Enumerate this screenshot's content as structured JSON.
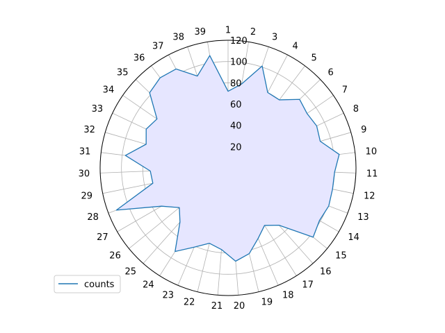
{
  "chart_data": {
    "type": "radar",
    "categories": [
      "1",
      "2",
      "3",
      "4",
      "5",
      "6",
      "7",
      "8",
      "9",
      "10",
      "11",
      "12",
      "13",
      "14",
      "15",
      "16",
      "17",
      "18",
      "19",
      "20",
      "21",
      "22",
      "23",
      "24",
      "25",
      "26",
      "27",
      "28",
      "29",
      "30",
      "31",
      "32",
      "33",
      "34",
      "35",
      "36",
      "37",
      "38",
      "39"
    ],
    "series": [
      {
        "name": "counts",
        "color": "#1f77b4",
        "fill": "#e6e6ff",
        "values": [
          72,
          80,
          101,
          80,
          80,
          93,
          90,
          92,
          90,
          105,
          100,
          100,
          101,
          99,
          103,
          72,
          64,
          72,
          83,
          88,
          77,
          73,
          81,
          93,
          68,
          59,
          72,
          112,
          72,
          73,
          97,
          80,
          85,
          81,
          102,
          106,
          105,
          91,
          107
        ]
      }
    ],
    "rticks": [
      20,
      40,
      60,
      80,
      100,
      120
    ],
    "rlim": [
      0,
      120
    ],
    "grid": true,
    "legend_position": "lower-left"
  }
}
